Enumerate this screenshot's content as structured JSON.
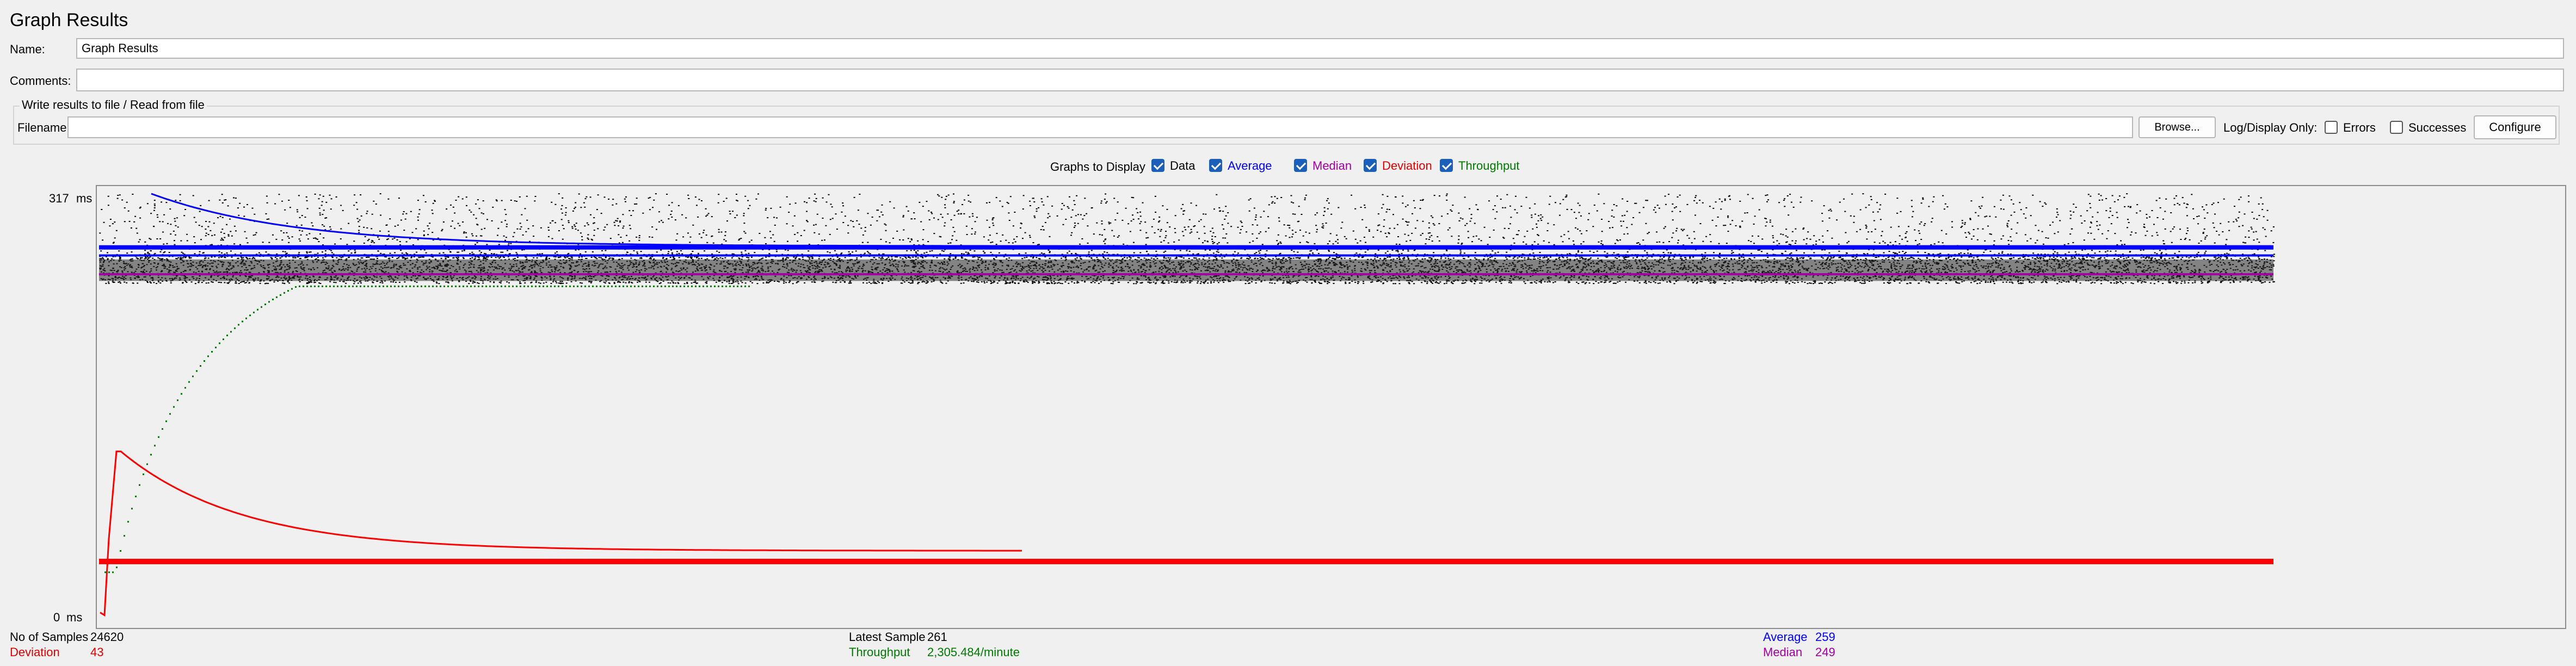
{
  "window_title": "Graph Results",
  "name": {
    "label": "Name:",
    "value": "Graph Results"
  },
  "comments": {
    "label": "Comments:",
    "value": ""
  },
  "file_group": {
    "title": "Write results to file / Read from file",
    "filename_label": "Filename",
    "filename_value": "",
    "browse_label": "Browse...",
    "log_display_label": "Log/Display Only:",
    "errors_label": "Errors",
    "errors_checked": false,
    "successes_label": "Successes",
    "successes_checked": false,
    "configure_label": "Configure"
  },
  "graphs_to_display": {
    "label": "Graphs to Display",
    "options": [
      {
        "label": "Data",
        "checked": true,
        "color": "#000000"
      },
      {
        "label": "Average",
        "checked": true,
        "color": "#0000ff"
      },
      {
        "label": "Median",
        "checked": true,
        "color": "#a000a0"
      },
      {
        "label": "Deviation",
        "checked": true,
        "color": "#e00000"
      },
      {
        "label": "Throughput",
        "checked": true,
        "color": "#007a00"
      }
    ]
  },
  "y_axis": {
    "max_label": "317",
    "min_label": "0",
    "unit": "ms"
  },
  "stats": {
    "samples_label": "No of Samples",
    "samples_value": "24620",
    "deviation_label": "Deviation",
    "deviation_value": "43",
    "latest_label": "Latest Sample",
    "latest_value": "261",
    "throughput_label": "Throughput",
    "throughput_value": "2,305.484/minute",
    "average_label": "Average",
    "average_value": "259",
    "median_label": "Median",
    "median_value": "249"
  },
  "colors": {
    "data": "#000000",
    "average": "#0000ff",
    "median": "#a000a0",
    "deviation": "#ff0000",
    "throughput": "#007a00"
  },
  "chart_data": {
    "type": "scatter",
    "title": "",
    "ylabel": "ms",
    "ylim": [
      0,
      317
    ],
    "samples_total": 24620,
    "series": [
      {
        "name": "Data",
        "final_value": 261
      },
      {
        "name": "Average",
        "start_value": 317,
        "final_value": 259
      },
      {
        "name": "Median",
        "final_value": 249
      },
      {
        "name": "Deviation",
        "peak_value": 125,
        "final_value": 43
      },
      {
        "name": "Throughput",
        "final_value": 2305.484
      }
    ]
  }
}
